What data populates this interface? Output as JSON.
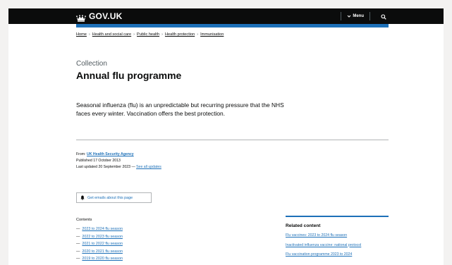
{
  "header": {
    "brand": "GOV.UK",
    "menu_label": "Menu"
  },
  "breadcrumbs": [
    "Home",
    "Health and social care",
    "Public health",
    "Health protection",
    "Immunisation"
  ],
  "page": {
    "caption": "Collection",
    "title": "Annual flu programme",
    "lead": "Seasonal influenza (flu) is an unpredictable but recurring pressure that the NHS faces every winter. Vaccination offers the best protection."
  },
  "metadata": {
    "from_label": "From:",
    "from_org": "UK Health Security Agency",
    "published": "Published 17 October 2013",
    "updated": "Last updated 20 September 2023 —",
    "see_all": "See all updates"
  },
  "email_button": "Get emails about this page",
  "contents": {
    "heading": "Contents",
    "items": [
      "2023 to 2024 flu season",
      "2022 to 2023 flu season",
      "2021 to 2022 flu season",
      "2020 to 2021 flu season",
      "2019 to 2020 flu season"
    ]
  },
  "related": {
    "heading": "Related content",
    "items": [
      "Flu vaccines: 2023 to 2024 flu season",
      "Inactivated influenza vaccine: national protocol",
      "Flu vaccination programme 2023 to 2024"
    ]
  },
  "colors": {
    "header_bg": "#0b0c0c",
    "link": "#1d70b8",
    "page_bg": "#f3f2f1"
  },
  "icons": {
    "brand": "crown-icon",
    "menu": "chevron-down-icon",
    "search": "search-icon",
    "email": "bell-icon"
  }
}
